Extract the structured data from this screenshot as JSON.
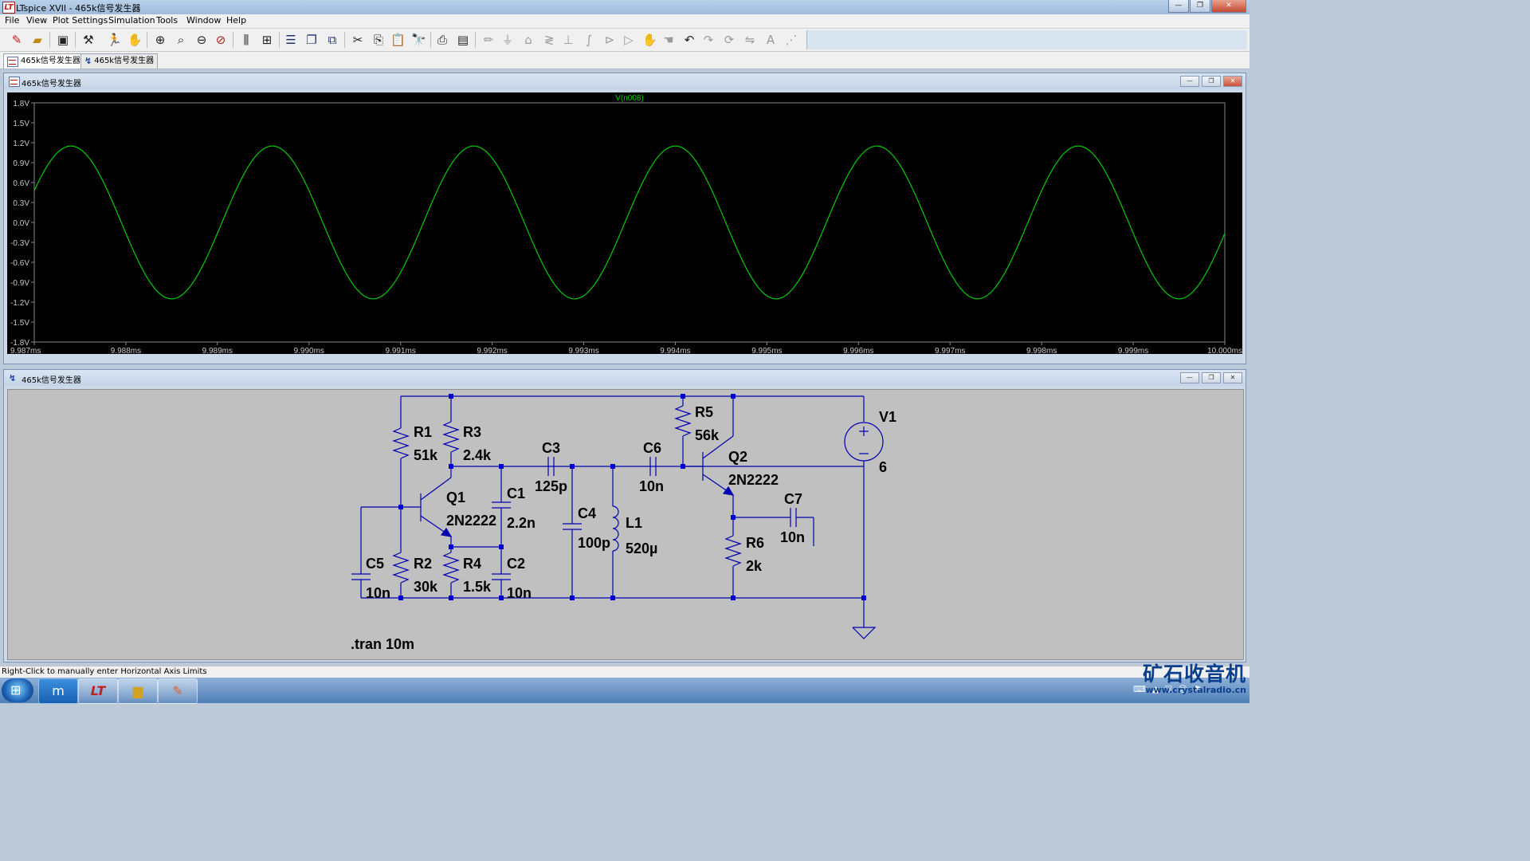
{
  "window": {
    "title": "LTspice XVII - 465k信号发生器",
    "minimize": "—",
    "restore": "❐",
    "close": "✕"
  },
  "menu": [
    "File",
    "View",
    "Plot Settings",
    "Simulation",
    "Tools",
    "Window",
    "Help"
  ],
  "tabs": [
    {
      "label": "465k信号发生器",
      "kind": "waveform"
    },
    {
      "label": "465k信号发生器",
      "kind": "schematic"
    }
  ],
  "plot_pane": {
    "title": "465k信号发生器"
  },
  "schematic_pane": {
    "title": "465k信号发生器"
  },
  "chart_data": {
    "type": "line",
    "title": "V(n008)",
    "xlabel": "",
    "ylabel": "",
    "xlim": [
      9.987,
      10.0
    ],
    "ylim": [
      -1.8,
      1.8
    ],
    "x_unit": "ms",
    "y_unit": "V",
    "grid": false,
    "y_ticks": [
      "1.8V",
      "1.5V",
      "1.2V",
      "0.9V",
      "0.6V",
      "0.3V",
      "0.0V",
      "-0.3V",
      "-0.6V",
      "-0.9V",
      "-1.2V",
      "-1.5V",
      "-1.8V"
    ],
    "x_ticks": [
      "9.987ms",
      "9.988ms",
      "9.989ms",
      "9.990ms",
      "9.991ms",
      "9.992ms",
      "9.993ms",
      "9.994ms",
      "9.995ms",
      "9.996ms",
      "9.997ms",
      "9.998ms",
      "9.999ms",
      "10.000ms"
    ],
    "series": [
      {
        "name": "V(n008)",
        "color": "#00cc00",
        "amplitude": 1.15,
        "frequency_mhz_per_ms": 0.465,
        "first_peak_ms": 9.9874,
        "peaks_ms": [
          9.9874,
          9.9896,
          9.9917,
          9.9939,
          9.996,
          9.9982
        ],
        "troughs_ms": [
          9.9885,
          9.9907,
          9.9928,
          9.995,
          9.9971,
          9.9993
        ]
      }
    ]
  },
  "schematic": {
    "components": [
      {
        "ref": "R1",
        "value": "51k"
      },
      {
        "ref": "R3",
        "value": "2.4k"
      },
      {
        "ref": "R5",
        "value": "56k"
      },
      {
        "ref": "C3",
        "value": "125p"
      },
      {
        "ref": "C6",
        "value": "10n"
      },
      {
        "ref": "Q1",
        "value": "2N2222"
      },
      {
        "ref": "Q2",
        "value": "2N2222"
      },
      {
        "ref": "C1",
        "value": "2.2n"
      },
      {
        "ref": "C4",
        "value": "100p"
      },
      {
        "ref": "L1",
        "value": "520µ"
      },
      {
        "ref": "C7",
        "value": "10n"
      },
      {
        "ref": "V1",
        "value": "6"
      },
      {
        "ref": "R6",
        "value": "2k"
      },
      {
        "ref": "C5",
        "value": "10n"
      },
      {
        "ref": "R2",
        "value": "30k"
      },
      {
        "ref": "R4",
        "value": "1.5k"
      },
      {
        "ref": "C2",
        "value": "10n"
      }
    ],
    "directive": ".tran 10m"
  },
  "status": {
    "text": "Right-Click to manually enter Horizontal Axis Limits"
  },
  "watermark": {
    "title": "矿石收音机",
    "url": "www.crystalradio.cn"
  }
}
